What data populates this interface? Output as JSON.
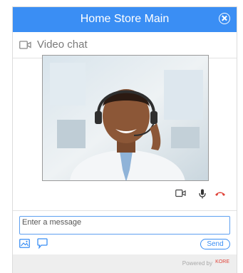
{
  "header": {
    "title": "Home Store Main"
  },
  "subheader": {
    "label": "Video chat"
  },
  "composer": {
    "placeholder": "Enter a message",
    "send_label": "Send"
  },
  "footer": {
    "powered_by": "Powered by",
    "brand": "KORE"
  },
  "colors": {
    "accent": "#3a8ef4",
    "hangup": "#e0453b"
  },
  "icons": [
    "close-icon",
    "video-camera-icon",
    "microphone-icon",
    "hang-up-icon",
    "image-icon",
    "chat-bubble-icon"
  ]
}
